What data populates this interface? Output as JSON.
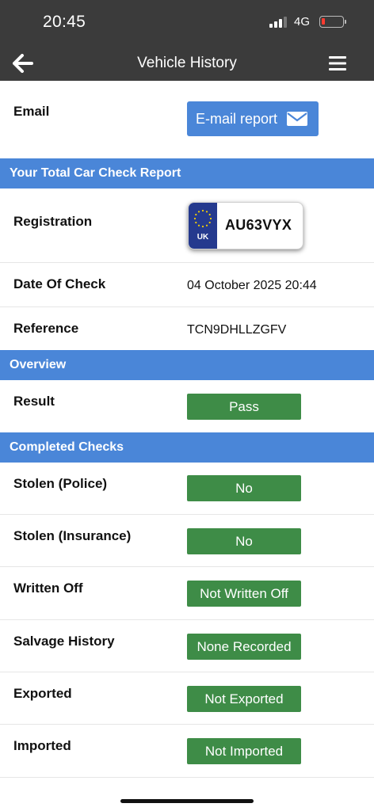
{
  "status_bar": {
    "time": "20:45",
    "network": "4G",
    "battery_color": "#ff3b30"
  },
  "nav": {
    "title": "Vehicle History",
    "back_icon": "arrow-left-icon",
    "menu_icon": "hamburger-menu-icon"
  },
  "email": {
    "label": "Email",
    "button_label": "E-mail report",
    "icon": "envelope-icon"
  },
  "report_header": "Your Total Car Check Report",
  "registration": {
    "label": "Registration",
    "plate_country": "UK",
    "plate_number": "AU63VYX"
  },
  "date_of_check": {
    "label": "Date Of Check",
    "value": "04 October 2025 20:44"
  },
  "reference": {
    "label": "Reference",
    "value": "TCN9DHLLZGFV"
  },
  "overview_header": "Overview",
  "result": {
    "label": "Result",
    "value": "Pass"
  },
  "checks_header": "Completed Checks",
  "checks": [
    {
      "label": "Stolen (Police)",
      "value": "No"
    },
    {
      "label": "Stolen (Insurance)",
      "value": "No"
    },
    {
      "label": "Written Off",
      "value": "Not Written Off"
    },
    {
      "label": "Salvage History",
      "value": "None Recorded"
    },
    {
      "label": "Exported",
      "value": "Not Exported"
    },
    {
      "label": "Imported",
      "value": "Not Imported"
    }
  ],
  "colors": {
    "header_bg": "#3b3b3b",
    "section_blue": "#4a86d8",
    "pass_green": "#3e8c47",
    "plate_blue": "#253a8e"
  }
}
